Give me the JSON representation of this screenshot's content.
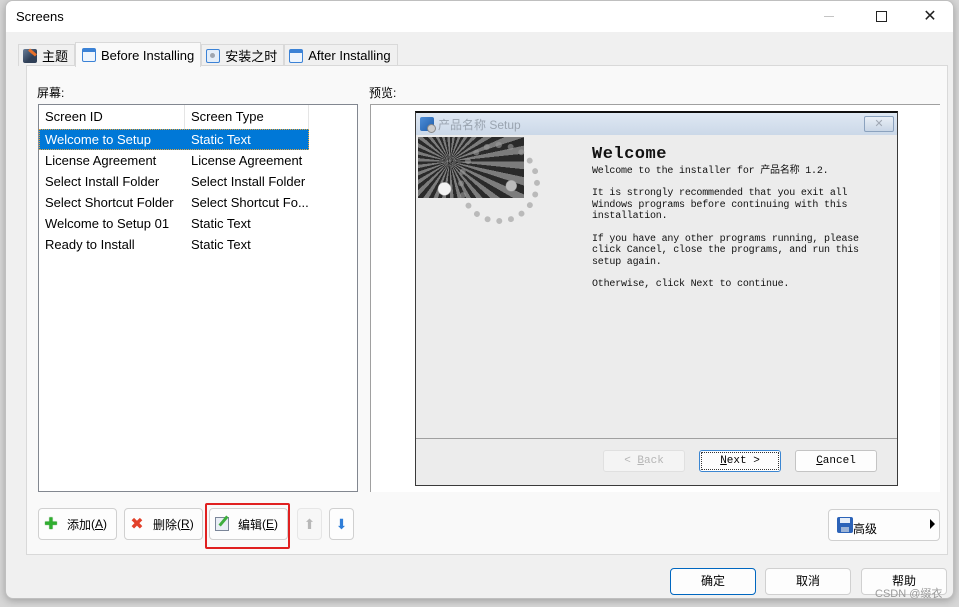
{
  "window": {
    "title": "Screens",
    "controls": {
      "minimize": "—",
      "maximize": "□",
      "close": "✕"
    }
  },
  "tabs": [
    {
      "label": "主题",
      "icon": "theme-icon",
      "active": false
    },
    {
      "label": "Before Installing",
      "icon": "window-icon",
      "active": true
    },
    {
      "label": "安装之时",
      "icon": "gear-window-icon",
      "active": false
    },
    {
      "label": "After Installing",
      "icon": "window-icon",
      "active": false
    }
  ],
  "screens": {
    "label": "屏幕:",
    "columns": [
      "Screen ID",
      "Screen Type"
    ],
    "rows": [
      {
        "id": "Welcome to Setup",
        "type": "Static Text",
        "selected": true
      },
      {
        "id": "License Agreement",
        "type": "License Agreement",
        "selected": false
      },
      {
        "id": "Select Install Folder",
        "type": "Select Install Folder",
        "selected": false
      },
      {
        "id": "Select Shortcut Folder",
        "type": "Select Shortcut Fo...",
        "selected": false
      },
      {
        "id": "Welcome to Setup 01",
        "type": "Static Text",
        "selected": false
      },
      {
        "id": "Ready to Install",
        "type": "Static Text",
        "selected": false
      }
    ]
  },
  "preview": {
    "label": "预览:",
    "setup_window": {
      "title": "产品名称 Setup",
      "close_glyph": "✕",
      "heading": "Welcome",
      "paragraphs": [
        "Welcome to the installer for 产品名称 1.2.",
        "It is strongly recommended that you exit all Windows programs before continuing with this installation.",
        "If you have any other programs running, please click Cancel, close the programs, and run this setup again.",
        "Otherwise, click Next to continue."
      ],
      "buttons": {
        "back": {
          "prefix": "< ",
          "mnemonic": "B",
          "rest": "ack",
          "enabled": false
        },
        "next": {
          "mnemonic": "N",
          "rest": "ext >",
          "enabled": true
        },
        "cancel": {
          "mnemonic": "C",
          "rest": "ancel",
          "enabled": true
        }
      }
    }
  },
  "actions": {
    "add": {
      "label": "添加",
      "mnemonic": "A"
    },
    "remove": {
      "label": "删除",
      "mnemonic": "R"
    },
    "edit": {
      "label": "编辑",
      "mnemonic": "E",
      "highlighted": true
    },
    "move_up": {
      "icon": "arrow-up-icon",
      "enabled": false
    },
    "move_down": {
      "icon": "arrow-down-icon",
      "enabled": true
    },
    "advanced": {
      "label": "高级"
    }
  },
  "footer": {
    "ok": "确定",
    "cancel": "取消",
    "help": "帮助"
  },
  "watermark": "CSDN @缀衣",
  "colors": {
    "selection": "#0078d7",
    "highlight_box": "#e02020",
    "ok_border": "#0067c0"
  }
}
